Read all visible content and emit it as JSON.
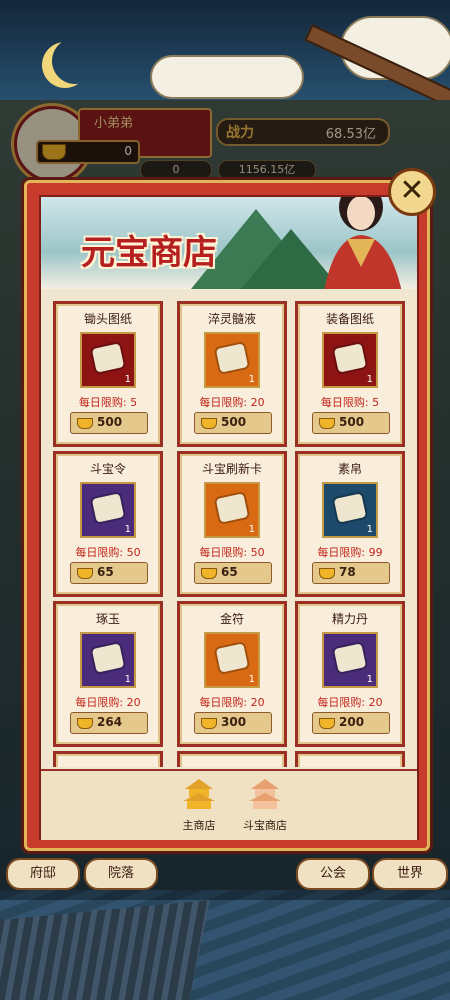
{
  "hud": {
    "player_name": "小弟弟",
    "ingot_value": "0",
    "power_label": "战力",
    "power_value": "68.53亿",
    "stat_a": "0",
    "stat_b": "1156.15亿"
  },
  "shop": {
    "title": "元宝商店",
    "close_label": "✕",
    "items": [
      {
        "name": "锄头图纸",
        "qty": "1",
        "limit": "每日限购: 5",
        "price": "500",
        "color": "#8e1414",
        "icon": "scroll-icon"
      },
      {
        "name": "淬灵髓液",
        "qty": "1",
        "limit": "每日限购: 20",
        "price": "500",
        "color": "#d76a12",
        "icon": "bottle-icon"
      },
      {
        "name": "装备图纸",
        "qty": "1",
        "limit": "每日限购: 5",
        "price": "500",
        "color": "#8e1414",
        "icon": "scroll-icon"
      },
      {
        "name": "斗宝令",
        "qty": "1",
        "limit": "每日限购: 50",
        "price": "65",
        "color": "#4a2c7a",
        "icon": "token-icon"
      },
      {
        "name": "斗宝刷新卡",
        "qty": "1",
        "limit": "每日限购: 50",
        "price": "65",
        "color": "#d76a12",
        "icon": "card-icon"
      },
      {
        "name": "素帛",
        "qty": "1",
        "limit": "每日限购: 99",
        "price": "78",
        "color": "#1d4a6a",
        "icon": "silk-icon"
      },
      {
        "name": "琢玉",
        "qty": "1",
        "limit": "每日限购: 20",
        "price": "264",
        "color": "#4a2c7a",
        "icon": "jade-icon"
      },
      {
        "name": "金符",
        "qty": "1",
        "limit": "每日限购: 20",
        "price": "300",
        "color": "#d76a12",
        "icon": "talisman-icon"
      },
      {
        "name": "精力丹",
        "qty": "1",
        "limit": "每日限购: 20",
        "price": "200",
        "color": "#4a2c7a",
        "icon": "pill-icon"
      }
    ],
    "tabs": [
      {
        "label": "主商店"
      },
      {
        "label": "斗宝商店"
      }
    ]
  },
  "game_nav": [
    {
      "label": "府邸"
    },
    {
      "label": "院落"
    },
    {
      "label": "公会"
    },
    {
      "label": "世界"
    }
  ]
}
